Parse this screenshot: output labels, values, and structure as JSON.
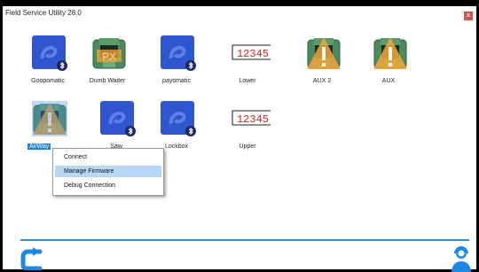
{
  "window": {
    "title": "Field Service Utility 28.0",
    "close_label": "x"
  },
  "devices": [
    {
      "name": "Goopomatic",
      "type": "bluetooth"
    },
    {
      "name": "Dumb Waiter",
      "type": "controller"
    },
    {
      "name": "payomatic",
      "type": "bluetooth"
    },
    {
      "name": "Lower",
      "type": "display",
      "display_value": "12345"
    },
    {
      "name": "AUX 2",
      "type": "controller-warning"
    },
    {
      "name": "AUX",
      "type": "controller-warning"
    },
    {
      "name": "AirWay",
      "type": "controller-selected",
      "selected": true
    },
    {
      "name": "Saw",
      "type": "bluetooth"
    },
    {
      "name": "Lockbox",
      "type": "bluetooth"
    },
    {
      "name": "Upper",
      "type": "display",
      "display_value": "12345"
    }
  ],
  "context_menu": {
    "items": [
      "Connect",
      "Manage Firmware",
      "Debug Connection"
    ],
    "highlighted": "Manage Firmware"
  },
  "colors": {
    "accent": "#2196f3",
    "selection": "#1e7fd6",
    "highlight": "#b7d7f5"
  },
  "icons": {
    "back": "back-arrow-icon",
    "support": "support-agent-icon",
    "bluetooth": "bluetooth-icon",
    "warning": "warning-icon"
  }
}
